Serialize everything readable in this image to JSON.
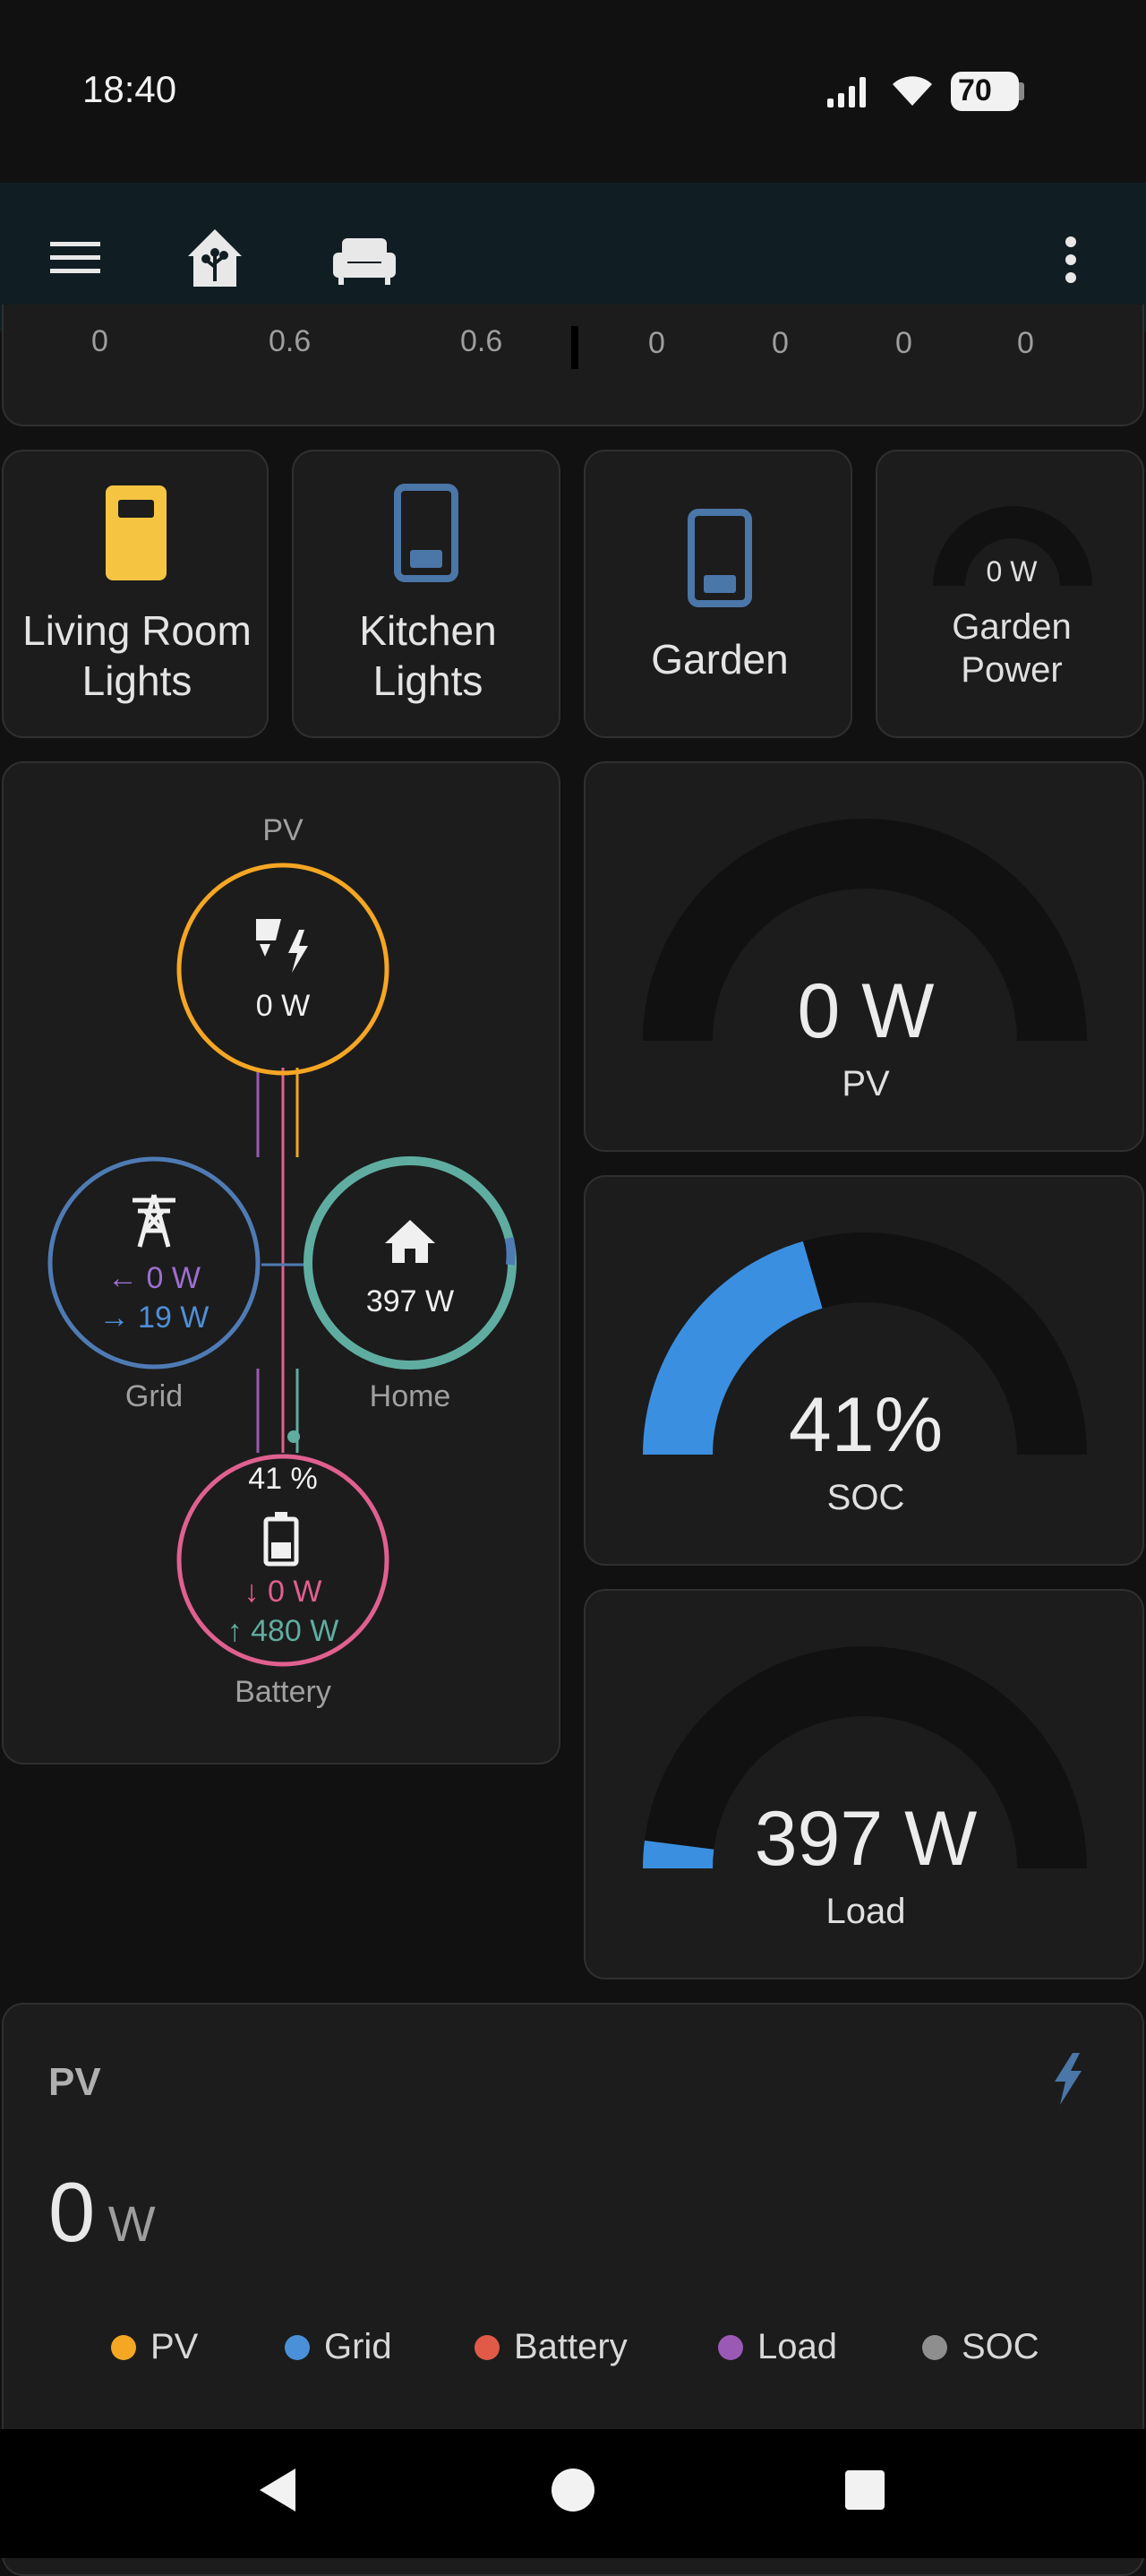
{
  "status": {
    "time": "18:40",
    "battery_level": "70"
  },
  "tabs": [
    {
      "icon": "home-assistant-icon"
    },
    {
      "icon": "sofa-icon"
    }
  ],
  "top_card_values": [
    "0",
    "0.6",
    "0.6",
    "0",
    "0",
    "0",
    "0"
  ],
  "tiles": [
    {
      "label_line1": "Living Room",
      "label_line2": "Lights",
      "state": "on",
      "color": "#f5c542"
    },
    {
      "label_line1": "Kitchen",
      "label_line2": "Lights",
      "state": "off",
      "color": "#4a76a8"
    },
    {
      "label_line1": "Garden",
      "label_line2": "",
      "state": "off",
      "color": "#4a76a8"
    },
    {
      "label_line1": "Garden",
      "label_line2": "Power",
      "gauge_value": "0 W"
    }
  ],
  "power_flow": {
    "pv": {
      "label": "PV",
      "value": "0 W",
      "color": "#f5a623"
    },
    "grid": {
      "label": "Grid",
      "import": "0 W",
      "export": "19 W",
      "color": "#4f7bb5"
    },
    "home": {
      "label": "Home",
      "value": "397 W",
      "color": "#5fada0"
    },
    "battery": {
      "label": "Battery",
      "soc": "41 %",
      "discharge": "0 W",
      "charge": "480 W",
      "color": "#e06090"
    }
  },
  "gauges": [
    {
      "value": "0 W",
      "label": "PV",
      "fraction": 0.0,
      "color": "#3b8fe0"
    },
    {
      "value": "41%",
      "label": "SOC",
      "fraction": 0.41,
      "color": "#3b8fe0"
    },
    {
      "value": "397 W",
      "label": "Load",
      "fraction": 0.04,
      "color": "#3b8fe0"
    }
  ],
  "pv_card": {
    "title": "PV",
    "value": "0",
    "unit": "W",
    "icon": "lightning-bolt-icon",
    "legend": [
      {
        "name": "PV",
        "color": "#f5a623"
      },
      {
        "name": "Grid",
        "color": "#4a90d9"
      },
      {
        "name": "Battery",
        "color": "#e05a47"
      },
      {
        "name": "Load",
        "color": "#9b59b6"
      },
      {
        "name": "SOC",
        "color": "#8e8e8e"
      }
    ]
  }
}
